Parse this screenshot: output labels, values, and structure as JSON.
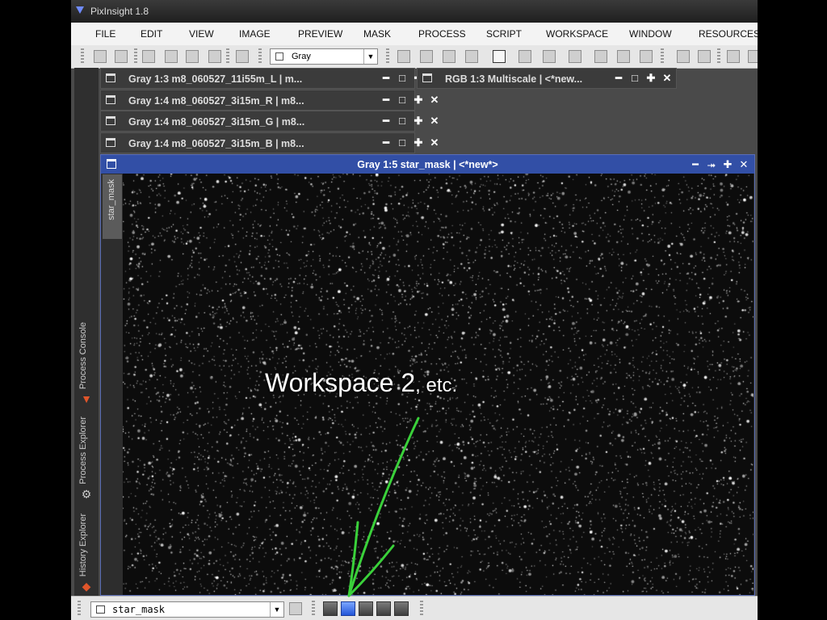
{
  "app": {
    "title": "PixInsight 1.8"
  },
  "menu": [
    "FILE",
    "EDIT",
    "VIEW",
    "IMAGE",
    "PREVIEW",
    "MASK",
    "PROCESS",
    "SCRIPT",
    "WORKSPACE",
    "WINDOW",
    "RESOURCES"
  ],
  "toolbar": {
    "view_selector": "Gray"
  },
  "sidebar": {
    "tabs": [
      {
        "label": "Process Console",
        "icon": "process-console-icon"
      },
      {
        "label": "Process Explorer",
        "icon": "gear-icon"
      },
      {
        "label": "History Explorer",
        "icon": "history-icon"
      }
    ]
  },
  "iconized_windows": [
    {
      "title": "Gray 1:3 m8_060527_11i55m_L | m..."
    },
    {
      "title": "Gray 1:4 m8_060527_3i15m_R | m8..."
    },
    {
      "title": "Gray 1:4 m8_060527_3i15m_G | m8..."
    },
    {
      "title": "Gray 1:4 m8_060527_3i15m_B | m8..."
    },
    {
      "title": "RGB 1:3 Multiscale | <*new..."
    }
  ],
  "image_window": {
    "title": "Gray 1:5 star_mask | <*new*>",
    "identifier": "star_mask"
  },
  "annotation": {
    "main": "Workspace 2",
    "suffix": ", etc.",
    "color": "#3ad13a"
  },
  "bottom_bar": {
    "view_list": "star_mask",
    "workspaces": [
      {
        "active": false
      },
      {
        "active": true
      },
      {
        "active": false
      },
      {
        "active": false
      },
      {
        "active": false
      }
    ]
  },
  "colors": {
    "title_bar_active": "#324fa6",
    "workspace_active": "#2356d8"
  }
}
